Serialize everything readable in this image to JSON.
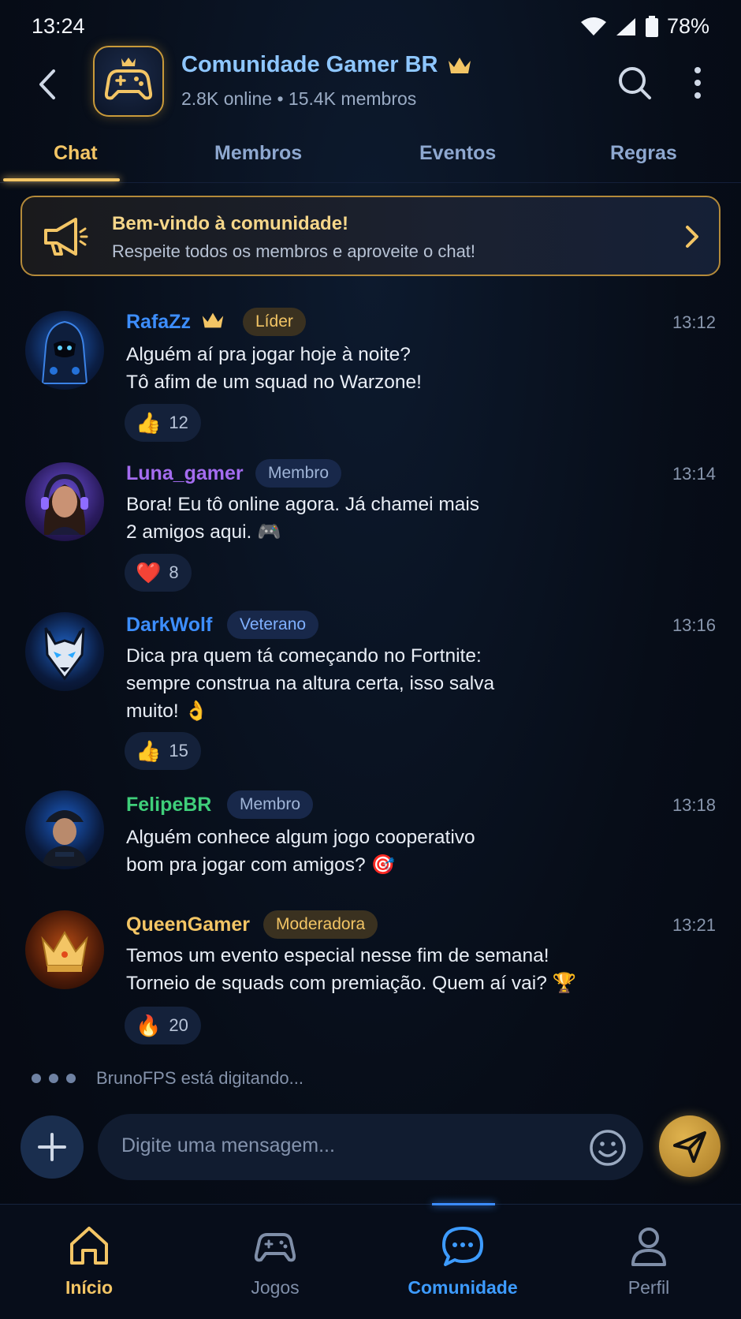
{
  "status": {
    "time": "13:24",
    "battery": "78%"
  },
  "header": {
    "title": "Comunidade Gamer BR",
    "subtitle": "2.8K online • 15.4K membros"
  },
  "tabs": [
    {
      "label": "Chat",
      "active": true
    },
    {
      "label": "Membros",
      "active": false
    },
    {
      "label": "Eventos",
      "active": false
    },
    {
      "label": "Regras",
      "active": false
    }
  ],
  "banner": {
    "title": "Bem-vindo à comunidade!",
    "text": "Respeite todos os membros e aproveite o chat!"
  },
  "messages": [
    {
      "name": "RafaZz",
      "name_color": "#3d8eff",
      "crown": true,
      "badge": "Líder",
      "badge_style": "gold",
      "time": "13:12",
      "text": "Alguém aí pra jogar hoje à noite?\nTô afim de um squad no Warzone!",
      "reaction_emoji": "👍",
      "reaction_count": "12",
      "avatar": "hooded-ninja"
    },
    {
      "name": "Luna_gamer",
      "name_color": "#a46cf0",
      "crown": false,
      "badge": "Membro",
      "badge_style": "blue",
      "time": "13:14",
      "text": "Bora! Eu tô online agora. Já chamei mais\n2 amigos aqui. 🎮",
      "reaction_emoji": "❤️",
      "reaction_count": "8",
      "avatar": "woman-headset"
    },
    {
      "name": "DarkWolf",
      "name_color": "#3d8eff",
      "crown": false,
      "badge": "Veterano",
      "badge_style": "blue",
      "time": "13:16",
      "text": "Dica pra quem tá começando no Fortnite:\nsempre construa na altura certa, isso salva\nmuito! 👌",
      "reaction_emoji": "👍",
      "reaction_count": "15",
      "avatar": "wolf"
    },
    {
      "name": "FelipeBR",
      "name_color": "#3fcf7a",
      "crown": false,
      "badge": "Membro",
      "badge_style": "blue",
      "time": "13:18",
      "text": "Alguém conhece algum jogo cooperativo\nbom pra jogar com amigos? 🎯",
      "reaction_emoji": "",
      "reaction_count": "",
      "avatar": "man-cap"
    },
    {
      "name": "QueenGamer",
      "name_color": "#f3c565",
      "crown": false,
      "badge": "Moderadora",
      "badge_style": "gold",
      "time": "13:21",
      "text": "Temos um evento especial nesse fim de semana!\nTorneio de squads com premiação. Quem aí vai? 🏆",
      "reaction_emoji": "🔥",
      "reaction_count": "20",
      "avatar": "crown"
    }
  ],
  "typing": "BrunoFPS está digitando...",
  "composer": {
    "placeholder": "Digite uma mensagem..."
  },
  "nav": [
    {
      "label": "Início",
      "icon": "home-icon",
      "color": "#f3c565"
    },
    {
      "label": "Jogos",
      "icon": "gamepad-icon",
      "color": "#7f8ea8"
    },
    {
      "label": "Comunidade",
      "icon": "chat-bubble-icon",
      "color": "#3d9bff"
    },
    {
      "label": "Perfil",
      "icon": "profile-icon",
      "color": "#7f8ea8"
    }
  ]
}
